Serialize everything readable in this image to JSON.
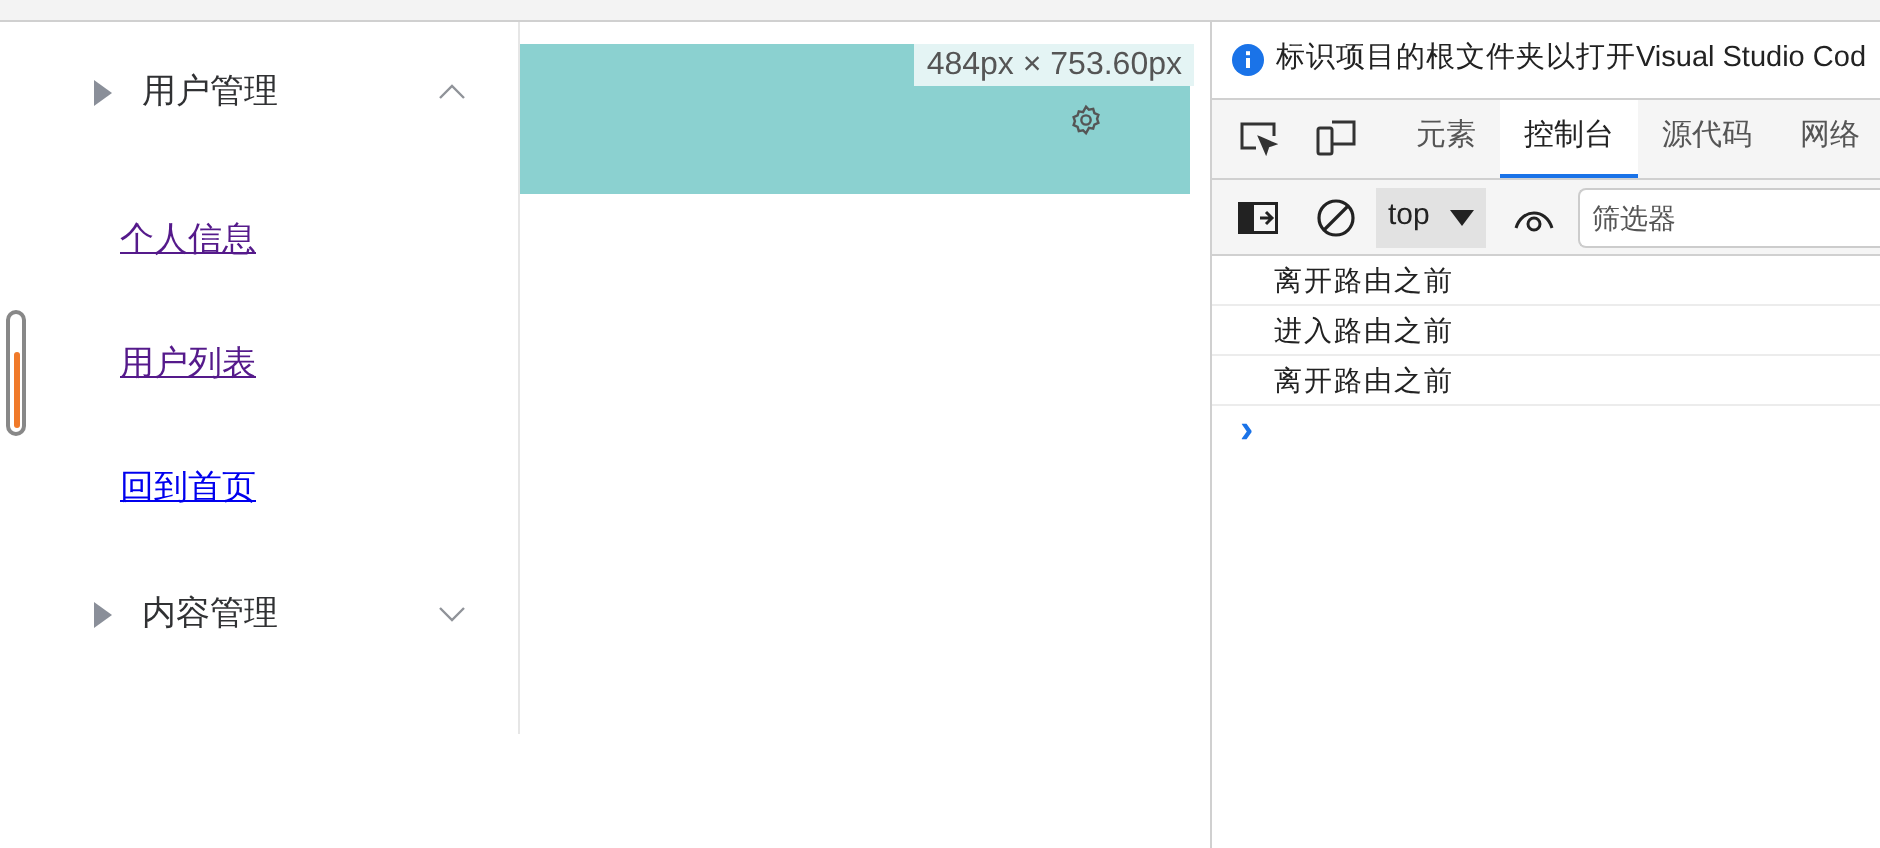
{
  "menu": [
    {
      "label": "用户管理",
      "expanded": true,
      "links": [
        {
          "label": "个人信息",
          "visited": true
        },
        {
          "label": "用户列表",
          "visited": true
        },
        {
          "label": "回到首页",
          "visited": false
        }
      ]
    },
    {
      "label": "内容管理",
      "expanded": false
    }
  ],
  "element_overlay": {
    "size": "484px × 753.60px"
  },
  "devtools": {
    "info_bar": "标识项目的根文件夹以打开Visual Studio Cod",
    "tabs": [
      {
        "label": "元素",
        "selected": false
      },
      {
        "label": "控制台",
        "selected": true
      },
      {
        "label": "源代码",
        "selected": false
      },
      {
        "label": "网络",
        "selected": false
      }
    ],
    "context": "top",
    "filter": {
      "placeholder": "筛选器"
    },
    "console_lines": [
      "离开路由之前",
      "进入路由之前",
      "离开路由之前"
    ],
    "prompt": "›"
  }
}
